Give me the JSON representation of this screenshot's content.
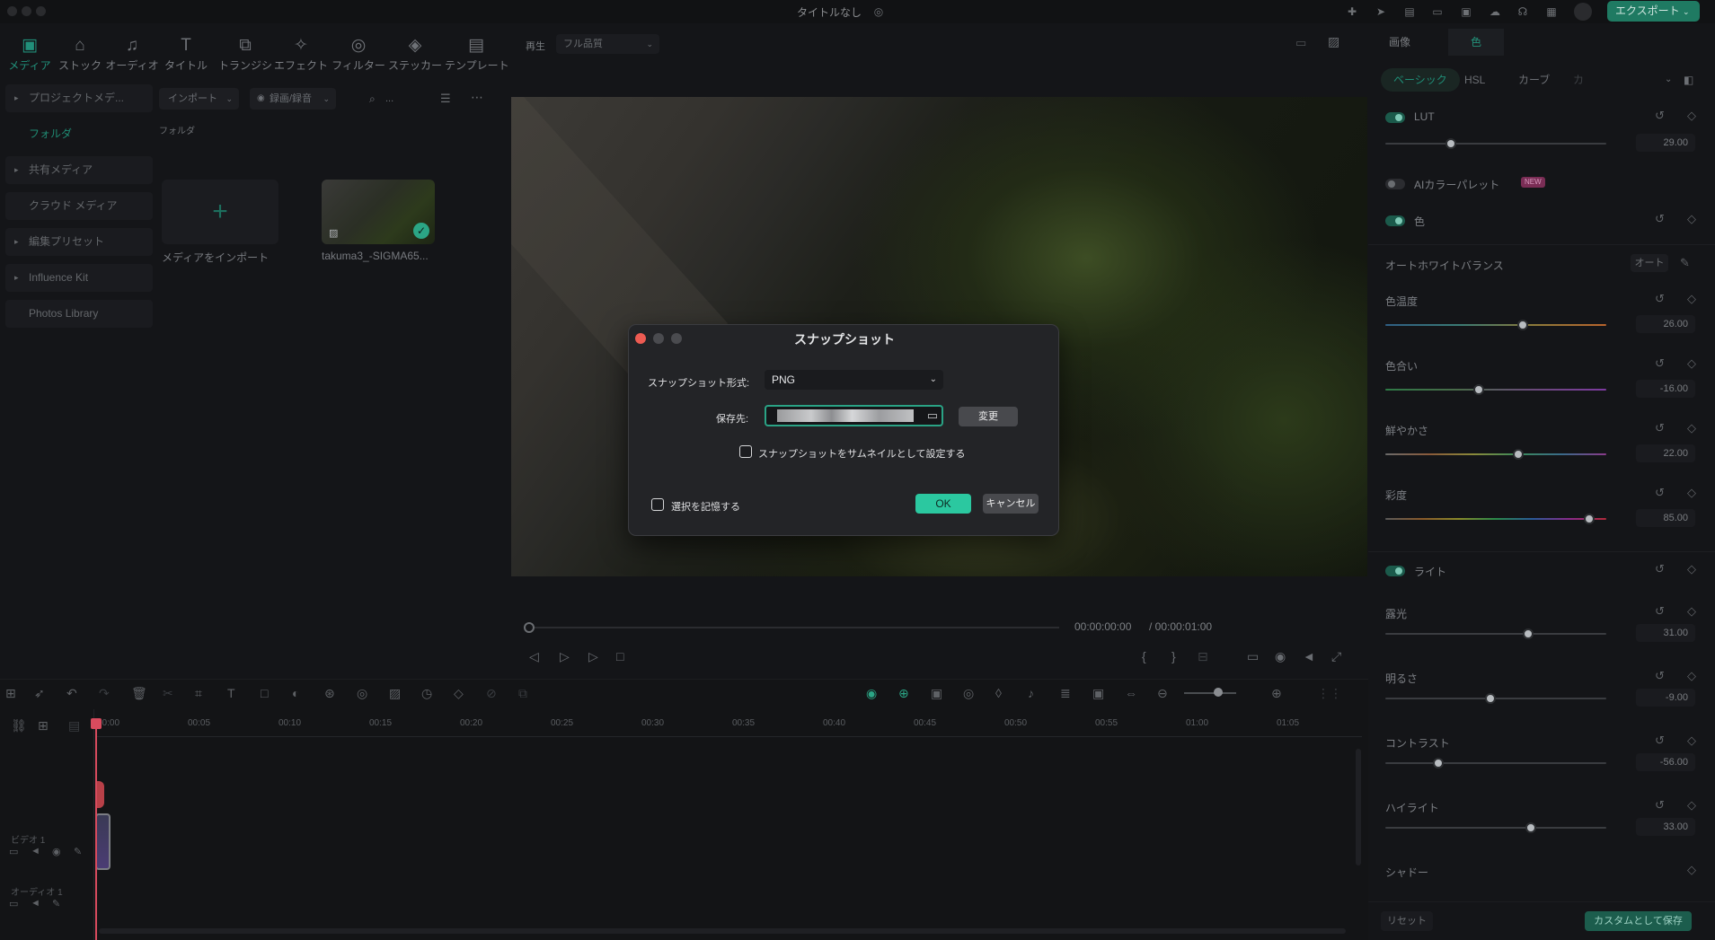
{
  "titlebar": {
    "title": "タイトルなし",
    "export_label": "エクスポート"
  },
  "media_tabs": [
    {
      "label": "メディア",
      "icon": "media-icon"
    },
    {
      "label": "ストック",
      "icon": "stock-icon"
    },
    {
      "label": "オーディオ",
      "icon": "music-icon"
    },
    {
      "label": "タイトル",
      "icon": "title-icon"
    },
    {
      "label": "トランジション",
      "icon": "transition-icon"
    },
    {
      "label": "エフェクト",
      "icon": "effect-icon"
    },
    {
      "label": "フィルター",
      "icon": "filter-icon"
    },
    {
      "label": "ステッカー",
      "icon": "sticker-icon"
    },
    {
      "label": "テンプレート",
      "icon": "template-icon"
    }
  ],
  "sidebar": {
    "items": [
      "プロジェクトメデ...",
      "フォルダ",
      "共有メディア",
      "クラウド メディア",
      "編集プリセット",
      "Influence Kit",
      "Photos Library"
    ]
  },
  "library": {
    "import_label": "インポート",
    "record_label": "録画/録音",
    "search_placeholder": "...",
    "folder_label": "フォルダ",
    "import_tile_label": "メディアをインポート",
    "clip_name": "takuma3_-SIGMA65..."
  },
  "preview": {
    "play_label": "再生",
    "quality": "フル品質",
    "timecode": "00:00:00:00",
    "total": "/ 00:00:01:00"
  },
  "right_panel": {
    "tabs": [
      "画像",
      "色"
    ],
    "subtabs": [
      "ベーシック",
      "HSL",
      "カーブ",
      "カ"
    ],
    "lut": {
      "label": "LUT",
      "value": "29.00",
      "level": 0.3
    },
    "ai_palette": {
      "label": "AIカラーパレット",
      "badge": "NEW"
    },
    "color": {
      "label": "色"
    },
    "auto_wb": {
      "label": "オートホワイトバランス",
      "button": "オート"
    },
    "temperature": {
      "label": "色温度",
      "value": "26.00"
    },
    "tint": {
      "label": "色合い",
      "value": "-16.00"
    },
    "vibrance": {
      "label": "鮮やかさ",
      "value": "22.00"
    },
    "saturation": {
      "label": "彩度",
      "value": "85.00"
    },
    "light": {
      "label": "ライト"
    },
    "exposure": {
      "label": "露光",
      "value": "31.00"
    },
    "brightness": {
      "label": "明るさ",
      "value": "-9.00"
    },
    "contrast": {
      "label": "コントラスト",
      "value": "-56.00"
    },
    "highlight": {
      "label": "ハイライト",
      "value": "33.00"
    },
    "shadow": {
      "label": "シャドー"
    },
    "reset_label": "リセット",
    "save_custom_label": "カスタムとして保存"
  },
  "timeline": {
    "ticks": [
      "00:00",
      "00:05",
      "00:10",
      "00:15",
      "00:20",
      "00:25",
      "00:30",
      "00:35",
      "00:40",
      "00:45",
      "00:50",
      "00:55",
      "01:00",
      "01:05"
    ],
    "video_track": "ビデオ 1",
    "audio_track": "オーディオ 1"
  },
  "dialog": {
    "title": "スナップショット",
    "format_label": "スナップショット形式:",
    "format_value": "PNG",
    "dest_label": "保存先:",
    "change_label": "変更",
    "thumbnail_label": "スナップショットをサムネイルとして設定する",
    "remember_label": "選択を記憶する",
    "ok_label": "OK",
    "cancel_label": "キャンセル"
  },
  "colors": {
    "accent": "#2bc8a0",
    "close": "#ed5b52"
  }
}
